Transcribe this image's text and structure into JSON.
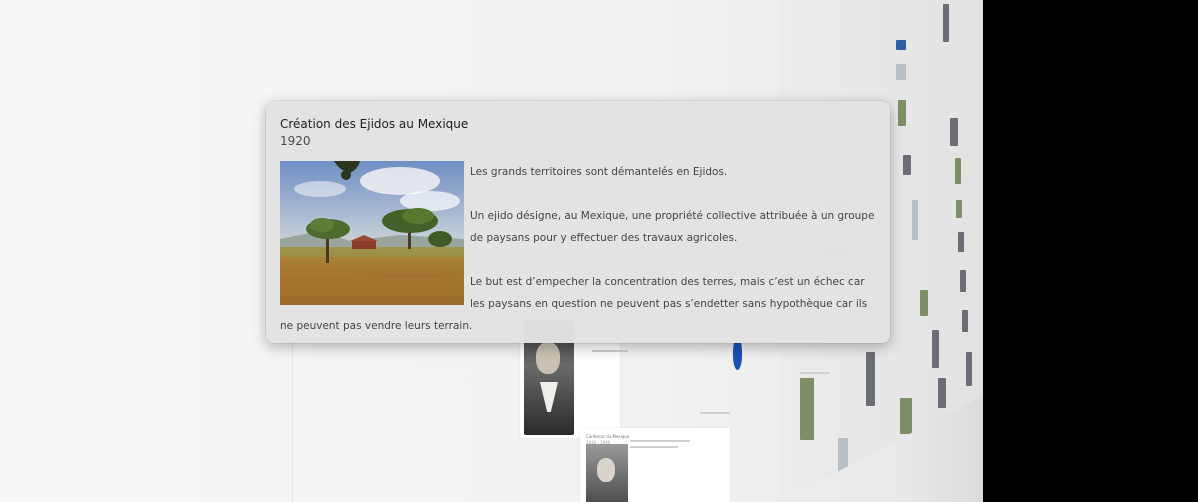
{
  "popup": {
    "title": "Création des Ejidos au Mexique",
    "year": "1920",
    "image": "landscape-photo-trees-dry-field",
    "paragraphs": [
      "Les grands territoires sont démantelés en Ejidos.",
      "Un ejido désigne, au Mexique, une propriété collective attribuée à un groupe de paysans pour y effectuer des travaux agricoles.",
      "Le but est d’empecher la concentration des terres, mais c’est un échec car les paysans en question ne peuvent pas s’endetter sans hypothèque car ils ne peuvent pas vendre leurs terrain."
    ]
  },
  "background": {
    "card1_title": "Cardenas du Mexique",
    "card1_year": "1934 - 1940"
  },
  "colors": {
    "popup_bg": "#e2e2e2",
    "stage_bg": "#f4f4f4",
    "edge": "#000000",
    "accent_blue": "#1e4fb5"
  }
}
